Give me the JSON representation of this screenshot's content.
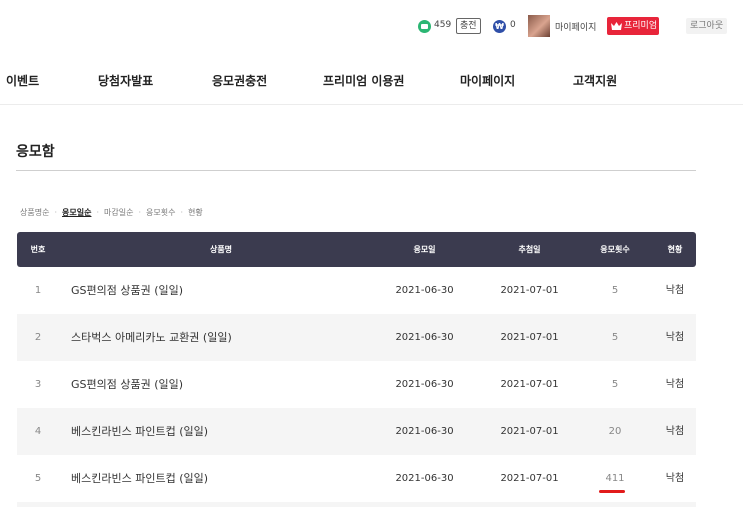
{
  "topbar": {
    "coin_count": "459",
    "charge_label": "충전",
    "won_symbol": "₩",
    "won_count": "0",
    "mypage_label": "마이페이지",
    "premium_label": "프리미엄",
    "logout_label": "로그아웃",
    "coin_color": "#2bb673",
    "won_color": "#2f4fa8",
    "premium_color": "#e8253a"
  },
  "nav": {
    "items": [
      "이벤트",
      "당첨자발표",
      "응모권충전",
      "프리미엄 이용권",
      "마이페이지",
      "고객지원"
    ]
  },
  "page_title": "응모함",
  "sort": {
    "items": [
      "상품명순",
      "응모일순",
      "마감일순",
      "응모횟수",
      "현황"
    ],
    "active_index": 1
  },
  "table": {
    "header_color": "#3b3b4f",
    "columns": [
      "번호",
      "상품명",
      "응모일",
      "추첨일",
      "응모횟수",
      "현황"
    ],
    "rows": [
      {
        "no": "1",
        "name": "GS편의점 상품권 (일일)",
        "entry_date": "2021-06-30",
        "draw_date": "2021-07-01",
        "count": "5",
        "status": "낙첨"
      },
      {
        "no": "2",
        "name": "스타벅스 아메리카노 교환권 (일일)",
        "entry_date": "2021-06-30",
        "draw_date": "2021-07-01",
        "count": "5",
        "status": "낙첨"
      },
      {
        "no": "3",
        "name": "GS편의점 상품권 (일일)",
        "entry_date": "2021-06-30",
        "draw_date": "2021-07-01",
        "count": "5",
        "status": "낙첨"
      },
      {
        "no": "4",
        "name": "베스킨라빈스 파인트컵 (일일)",
        "entry_date": "2021-06-30",
        "draw_date": "2021-07-01",
        "count": "20",
        "status": "낙첨"
      },
      {
        "no": "5",
        "name": "베스킨라빈스 파인트컵 (일일)",
        "entry_date": "2021-06-30",
        "draw_date": "2021-07-01",
        "count": "411",
        "status": "낙첨"
      }
    ]
  }
}
